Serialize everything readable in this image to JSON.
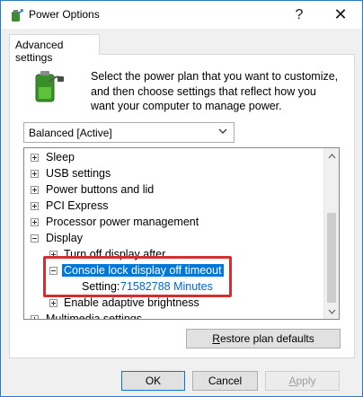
{
  "window": {
    "title": "Power Options",
    "help_glyph": "?",
    "close_glyph": "✕"
  },
  "tab": {
    "label": "Advanced settings"
  },
  "description": "Select the power plan that you want to customize, and then choose settings that reflect how you want your computer to manage power.",
  "plan": {
    "selected": "Balanced [Active]"
  },
  "tree": {
    "items": [
      {
        "label": "Sleep",
        "state": "collapsed"
      },
      {
        "label": "USB settings",
        "state": "collapsed"
      },
      {
        "label": "Power buttons and lid",
        "state": "collapsed"
      },
      {
        "label": "PCI Express",
        "state": "collapsed"
      },
      {
        "label": "Processor power management",
        "state": "collapsed"
      },
      {
        "label": "Display",
        "state": "expanded"
      },
      {
        "label": "Turn off display after",
        "state": "collapsed"
      },
      {
        "label": "Console lock display off timeout",
        "state": "expanded",
        "selected": true
      },
      {
        "label": "Enable adaptive brightness",
        "state": "collapsed"
      },
      {
        "label": "Multimedia settings",
        "state": "collapsed"
      }
    ],
    "setting": {
      "key": "Setting:",
      "value": "71582788 Minutes"
    }
  },
  "buttons": {
    "restore_prefix": "R",
    "restore_rest": "estore plan defaults",
    "ok": "OK",
    "cancel": "Cancel",
    "apply_prefix": "A",
    "apply_rest": "pply"
  },
  "colors": {
    "selection": "#0078d7",
    "setting_value": "#0066cc",
    "highlight": "#d32f2f"
  }
}
